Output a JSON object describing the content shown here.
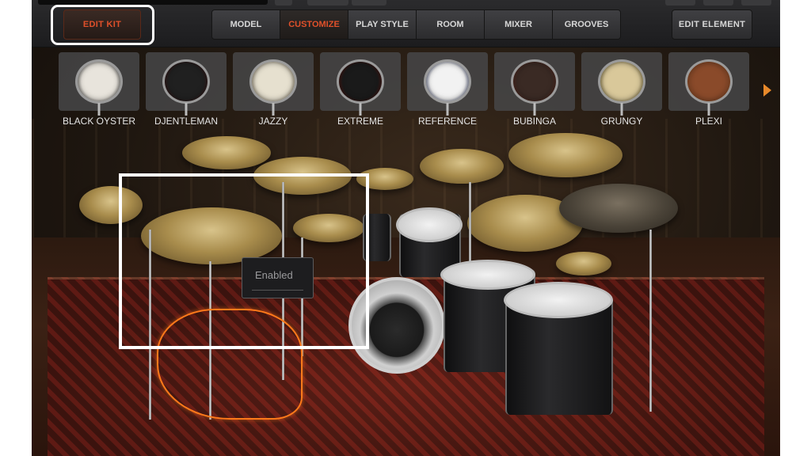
{
  "toolbar": {
    "edit_kit": "EDIT KIT",
    "edit_element": "EDIT ELEMENT",
    "tabs": [
      {
        "label": "MODEL",
        "active": false
      },
      {
        "label": "CUSTOMIZE",
        "active": true
      },
      {
        "label": "PLAY STYLE",
        "active": false
      },
      {
        "label": "ROOM",
        "active": false
      },
      {
        "label": "MIXER",
        "active": false
      },
      {
        "label": "GROOVES",
        "active": false
      }
    ],
    "accent_color": "#e0502a"
  },
  "kits": [
    {
      "label": "BLACK OYSTER",
      "head": "#e8e4dc",
      "shell": "#3a3a3a"
    },
    {
      "label": "DJENTLEMAN",
      "head": "#202020",
      "shell": "#5a1a1a"
    },
    {
      "label": "JAZZY",
      "head": "#e6e0cf",
      "shell": "#8a7a5a"
    },
    {
      "label": "EXTREME",
      "head": "#1a1a1a",
      "shell": "#8a1a10"
    },
    {
      "label": "REFERENCE",
      "head": "#f2f2f2",
      "shell": "#1c2a6a"
    },
    {
      "label": "BUBINGA",
      "head": "#3a2a24",
      "shell": "#8a3a2a"
    },
    {
      "label": "GRUNGY",
      "head": "#d9c89a",
      "shell": "#7a6a2a"
    },
    {
      "label": "PLEXI",
      "head": "#8a4a2a",
      "shell": "#c06a30"
    }
  ],
  "next_arrow_icon": "chevron-right-icon",
  "tooltip": {
    "label": "Enabled"
  }
}
